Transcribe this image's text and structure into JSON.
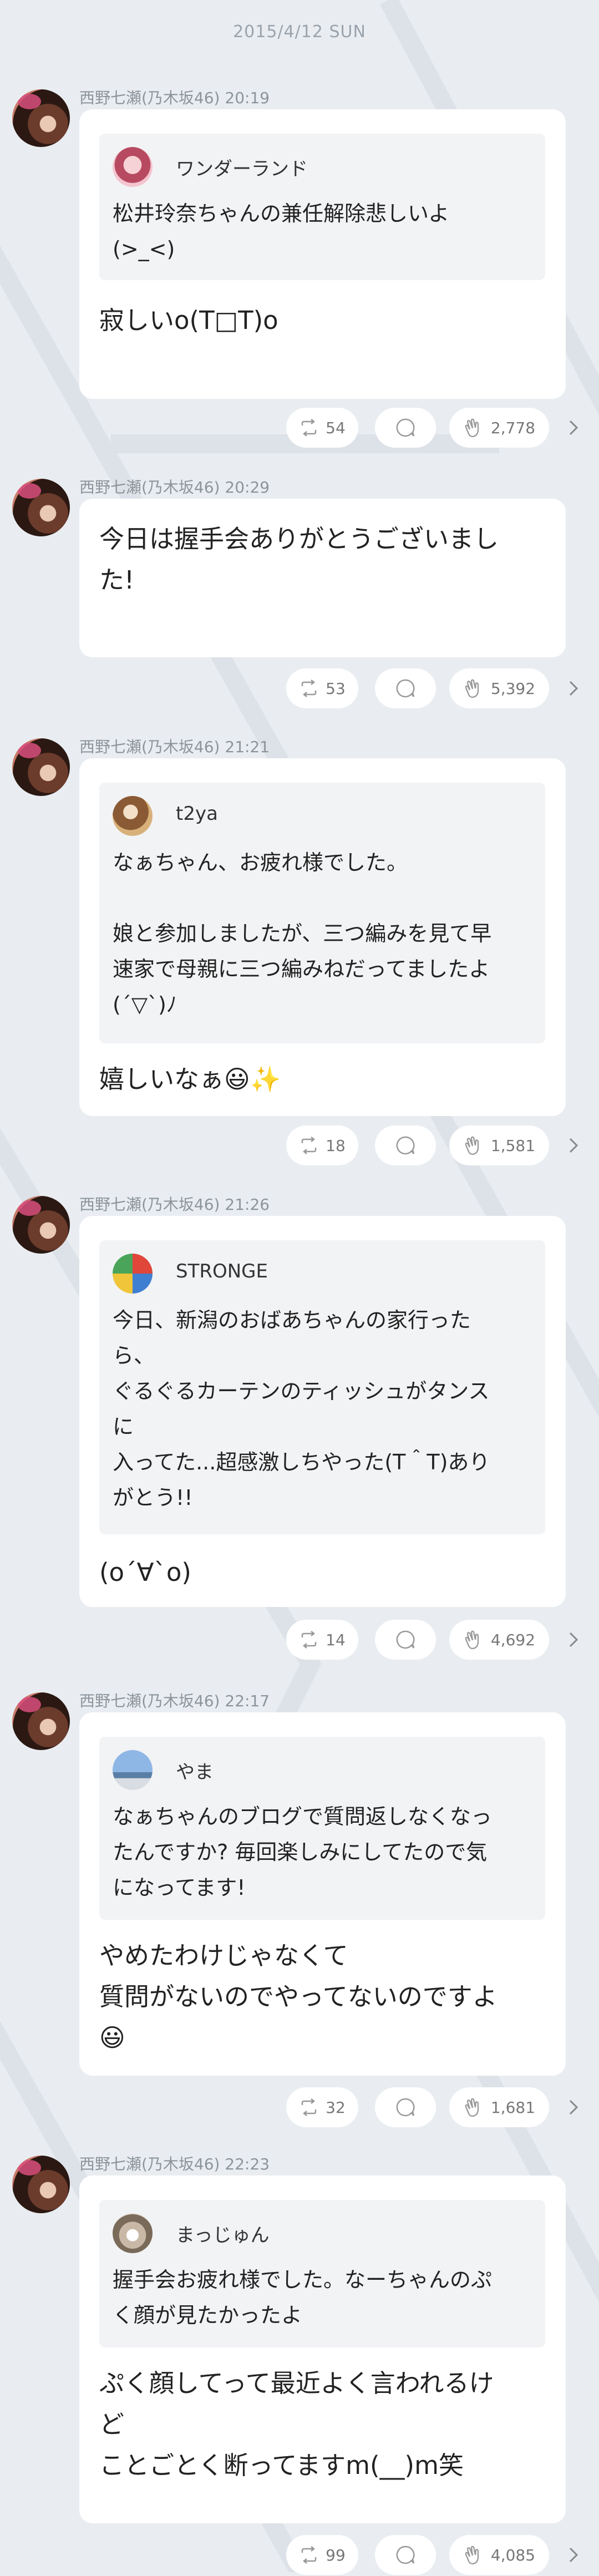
{
  "date": "2015/4/12 SUN",
  "posts": [
    {
      "author": "西野七瀬(乃木坂46)",
      "time": "20:19",
      "quote": {
        "name": "ワンダーランド",
        "text": "松井玲奈ちゃんの兼任解除悲しいよ\n(>_<)",
        "avatar": "pink"
      },
      "reply": "寂しいo(T□T)o",
      "repost": "54",
      "likes": "2,778"
    },
    {
      "author": "西野七瀬(乃木坂46)",
      "time": "20:29",
      "reply": "今日は握手会ありがとうございまし\nた!",
      "repost": "53",
      "likes": "5,392"
    },
    {
      "author": "西野七瀬(乃木坂46)",
      "time": "21:21",
      "quote": {
        "name": "t2ya",
        "text": "なぁちゃん、お疲れ様でした。\n\n娘と参加しましたが、三つ編みを見て早\n速家で母親に三つ編みねだってましたよ\n(´▽`)ﾉ",
        "avatar": "brown"
      },
      "reply": "嬉しいなぁ😃✨",
      "repost": "18",
      "likes": "1,581"
    },
    {
      "author": "西野七瀬(乃木坂46)",
      "time": "21:26",
      "quote": {
        "name": "STRONGE",
        "text": "今日、新潟のおばあちゃんの家行った\nら、\nぐるぐるカーテンのティッシュがタンス\nに\n入ってた...超感激しちやった(T＾T)あり\nがとう!!",
        "avatar": "colorful"
      },
      "reply": "(o´∀`o)",
      "repost": "14",
      "likes": "4,692"
    },
    {
      "author": "西野七瀬(乃木坂46)",
      "time": "22:17",
      "quote": {
        "name": "やま",
        "text": "なぁちゃんのブログで質問返しなくなっ\nたんですか? 毎回楽しみにしてたので気\nになってます!",
        "avatar": "sky"
      },
      "reply": "やめたわけじゃなくて\n質問がないのでやってないのですよ\n😃",
      "repost": "32",
      "likes": "1,681"
    },
    {
      "author": "西野七瀬(乃木坂46)",
      "time": "22:23",
      "quote": {
        "name": "まっじゅん",
        "text": "握手会お疲れ様でした。なーちゃんのぷ\nく顔が見たかったよ",
        "avatar": "cat"
      },
      "reply": "ぷく顔してって最近よく言われるけ\nど\nことごとく断ってますm(__)m笑",
      "repost": "99",
      "likes": "4,085"
    }
  ]
}
